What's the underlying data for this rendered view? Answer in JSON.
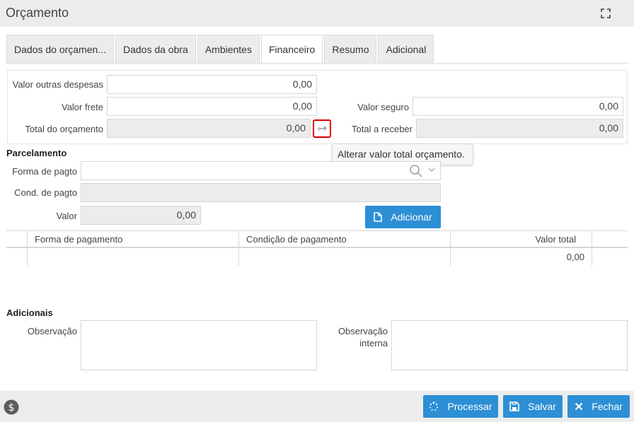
{
  "window": {
    "title": "Orçamento"
  },
  "tabs": [
    {
      "label": "Dados do orçamen..."
    },
    {
      "label": "Dados da obra"
    },
    {
      "label": "Ambientes"
    },
    {
      "label": "Financeiro",
      "active": true
    },
    {
      "label": "Resumo"
    },
    {
      "label": "Adicional"
    }
  ],
  "financeiro": {
    "outras_despesas": {
      "label": "Valor outras despesas",
      "value": "0,00"
    },
    "frete": {
      "label": "Valor frete",
      "value": "0,00"
    },
    "seguro": {
      "label": "Valor seguro",
      "value": "0,00"
    },
    "total_orcamento": {
      "label": "Total do orçamento",
      "value": "0,00"
    },
    "total_receber": {
      "label": "Total a receber",
      "value": "0,00"
    }
  },
  "tooltip": {
    "text": "Alterar valor total orçamento."
  },
  "parcelamento": {
    "title": "Parcelamento",
    "forma_pagto": {
      "label": "Forma de pagto",
      "value": ""
    },
    "cond_pagto": {
      "label": "Cond. de pagto",
      "value": ""
    },
    "valor": {
      "label": "Valor",
      "value": "0,00"
    },
    "add_label": "Adicionar"
  },
  "grid": {
    "columns": [
      "Forma de pagamento",
      "Condição de pagamento",
      "Valor total"
    ],
    "rows": [
      {
        "forma": "",
        "condicao": "",
        "valor": "0,00"
      }
    ]
  },
  "adicionais": {
    "title": "Adicionais",
    "observacao_label": "Observação",
    "observacao_interna_label_1": "Observação",
    "observacao_interna_label_2": "interna"
  },
  "footer": {
    "processar_label": "Processar",
    "salvar_label": "Salvar",
    "fechar_label": "Fechar"
  },
  "colors": {
    "accent": "#2d8fd5",
    "highlight": "#e00000"
  }
}
